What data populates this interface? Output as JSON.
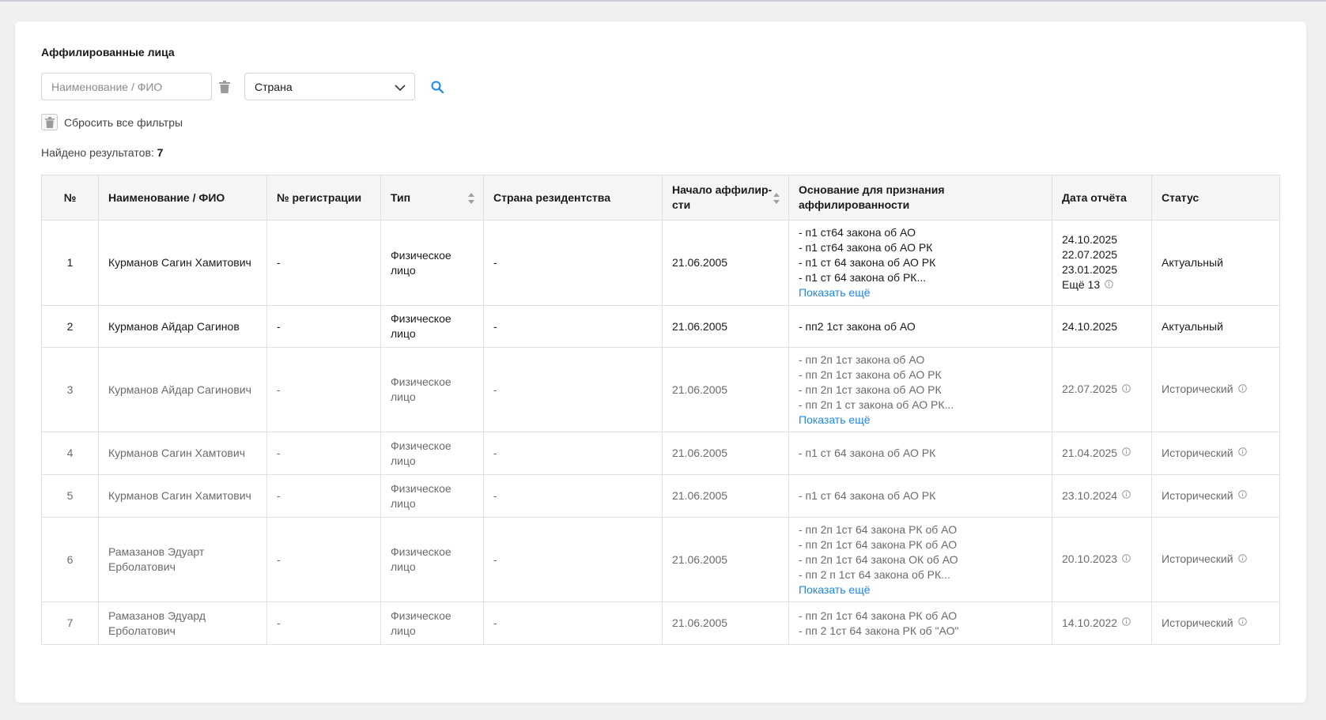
{
  "section_title": "Аффилированные лица",
  "filters": {
    "name_placeholder": "Наименование / ФИО",
    "name_value": "",
    "country_label": "Страна",
    "reset_label": "Сбросить все фильтры"
  },
  "results": {
    "label": "Найдено результатов:",
    "count": "7"
  },
  "columns": {
    "num": "№",
    "name": "Наименование / ФИО",
    "reg": "№ регистрации",
    "type": "Тип",
    "country": "Страна резидентства",
    "start_line1": "Начало аффилир-",
    "start_line2": "сти",
    "basis_line1": "Основание для признания",
    "basis_line2": "аффилированности",
    "date": "Дата отчёта",
    "status": "Статус"
  },
  "show_more_label": "Показать ещё",
  "rows": [
    {
      "num": "1",
      "name_line1": "Курманов Сагин Хамитович",
      "name_line2": "",
      "reg": "-",
      "type_line1": "Физическое",
      "type_line2": "лицо",
      "country": "-",
      "start": "21.06.2005",
      "basis": [
        "- п1 ст64 закона об АО",
        "- п1 ст64 закона об АО РК",
        "- п1 ст 64 закона об АО РК",
        "- п1 ст 64 закона об РК..."
      ],
      "dates": [
        "24.10.2025",
        "22.07.2025",
        "23.01.2025"
      ],
      "more_dates": "Ещё 13",
      "status": "Актуальный"
    },
    {
      "num": "2",
      "name_line1": "Курманов Айдар Сагинов",
      "name_line2": "",
      "reg": "-",
      "type_line1": "Физическое",
      "type_line2": "лицо",
      "country": "-",
      "start": "21.06.2005",
      "basis": [
        "- пп2 1ст закона об АО"
      ],
      "dates": [
        "24.10.2025"
      ],
      "status": "Актуальный"
    },
    {
      "num": "3",
      "name_line1": "Курманов Айдар Сагинович",
      "name_line2": "",
      "reg": "-",
      "type_line1": "Физическое",
      "type_line2": "лицо",
      "country": "-",
      "start": "21.06.2005",
      "basis": [
        "- пп 2п 1ст закона об АО",
        "- пп 2п 1ст закона об АО РК",
        "- пп 2п 1ст закона об АО РК",
        "- пп 2п 1 ст закона об АО РК..."
      ],
      "dates": [
        "22.07.2025"
      ],
      "status": "Исторический"
    },
    {
      "num": "4",
      "name_line1": "Курманов Сагин Хамтович",
      "name_line2": "",
      "reg": "-",
      "type_line1": "Физическое",
      "type_line2": "лицо",
      "country": "-",
      "start": "21.06.2005",
      "basis": [
        "- п1 ст 64 закона об АО РК"
      ],
      "dates": [
        "21.04.2025"
      ],
      "status": "Исторический"
    },
    {
      "num": "5",
      "name_line1": "Курманов Сагин Хамитович",
      "name_line2": "",
      "reg": "-",
      "type_line1": "Физическое",
      "type_line2": "лицо",
      "country": "-",
      "start": "21.06.2005",
      "basis": [
        "- п1 ст 64 закона об АО РК"
      ],
      "dates": [
        "23.10.2024"
      ],
      "status": "Исторический"
    },
    {
      "num": "6",
      "name_line1": "Рамазанов Эдуарт",
      "name_line2": "Ерболатович",
      "reg": "-",
      "type_line1": "Физическое",
      "type_line2": "лицо",
      "country": "-",
      "start": "21.06.2005",
      "basis": [
        "- пп 2п 1ст 64 закона РК об АО",
        "- пп 2п 1ст 64 закона РК об АО",
        "- пп 2п 1ст 64 закона ОК об АО",
        "- пп 2 п 1ст 64 закона об РК..."
      ],
      "dates": [
        "20.10.2023"
      ],
      "status": "Исторический"
    },
    {
      "num": "7",
      "name_line1": "Рамазанов Эдуард",
      "name_line2": "Ерболатович",
      "reg": "-",
      "type_line1": "Физическое",
      "type_line2": "лицо",
      "country": "-",
      "start": "21.06.2005",
      "basis": [
        "- пп 2п 1ст 64 закона РК об АО",
        "- пп 2 1ст 64 закона РК об \"АО\""
      ],
      "dates": [
        "14.10.2022"
      ],
      "status": "Исторический"
    }
  ]
}
